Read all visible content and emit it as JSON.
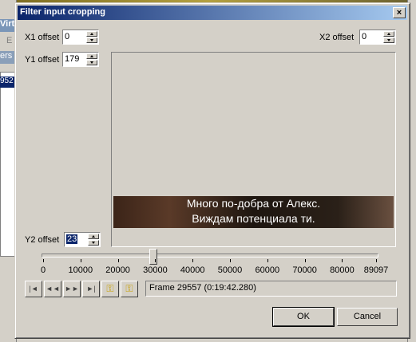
{
  "background": {
    "left_title": "Virt",
    "left_menu": "E",
    "left_title2": "ers",
    "left_list_item": "952"
  },
  "dialog": {
    "title": "Filter input cropping",
    "close_label": "×"
  },
  "fields": {
    "x1": {
      "label": "X1 offset",
      "value": "0"
    },
    "y1": {
      "label": "Y1 offset",
      "value": "179"
    },
    "x2": {
      "label": "X2 offset",
      "value": "0"
    },
    "y2": {
      "label": "Y2 offset",
      "value": "23"
    }
  },
  "preview": {
    "subtitle_line1": "Много по-добра от Алекс.",
    "subtitle_line2": "Виждам потенциала ти."
  },
  "slider": {
    "min": 0,
    "max": 89097,
    "value": 29557,
    "tick_labels": [
      "0",
      "10000",
      "20000",
      "30000",
      "40000",
      "50000",
      "60000",
      "70000",
      "80000",
      "89097"
    ]
  },
  "nav": {
    "icons": [
      "go-start-icon",
      "step-back-icon",
      "step-forward-icon",
      "go-end-icon",
      "key-prev-icon",
      "key-next-icon"
    ]
  },
  "status": {
    "frame_text": "Frame 29557 (0:19:42.280)"
  },
  "buttons": {
    "ok": "OK",
    "cancel": "Cancel"
  }
}
